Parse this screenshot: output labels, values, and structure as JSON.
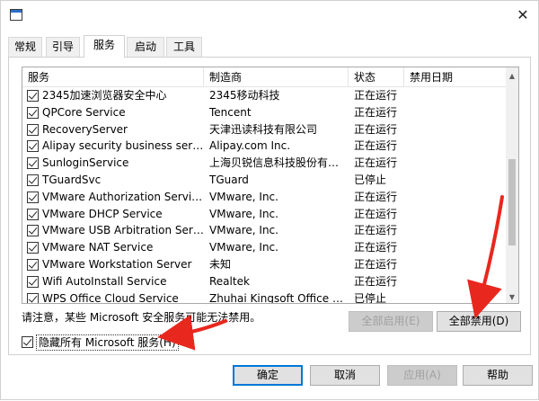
{
  "tabs": [
    "常规",
    "引导",
    "服务",
    "启动",
    "工具"
  ],
  "active_tab": "服务",
  "columns": [
    "服务",
    "制造商",
    "状态",
    "禁用日期"
  ],
  "services": [
    {
      "name": "2345加速浏览器安全中心",
      "maker": "2345移动科技",
      "status": "正在运行"
    },
    {
      "name": "QPCore Service",
      "maker": "Tencent",
      "status": "正在运行"
    },
    {
      "name": "RecoveryServer",
      "maker": "天津迅读科技有限公司",
      "status": "正在运行"
    },
    {
      "name": "Alipay security business service",
      "maker": "Alipay.com Inc.",
      "status": "正在运行"
    },
    {
      "name": "SunloginService",
      "maker": "上海贝锐信息科技股份有限公...",
      "status": "正在运行"
    },
    {
      "name": "TGuardSvc",
      "maker": "TGuard",
      "status": "已停止"
    },
    {
      "name": "VMware Authorization Service",
      "maker": "VMware, Inc.",
      "status": "正在运行"
    },
    {
      "name": "VMware DHCP Service",
      "maker": "VMware, Inc.",
      "status": "正在运行"
    },
    {
      "name": "VMware USB Arbitration Service",
      "maker": "VMware, Inc.",
      "status": "正在运行"
    },
    {
      "name": "VMware NAT Service",
      "maker": "VMware, Inc.",
      "status": "正在运行"
    },
    {
      "name": "VMware Workstation Server",
      "maker": "未知",
      "status": "正在运行"
    },
    {
      "name": "Wifi AutoInstall Service",
      "maker": "Realtek",
      "status": "正在运行"
    },
    {
      "name": "WPS Office Cloud Service",
      "maker": "Zhuhai Kingsoft Office Soft...",
      "status": "已停止"
    }
  ],
  "note": "请注意，某些 Microsoft 安全服务可能无法禁用。",
  "enable_all_label": "全部启用(E)",
  "disable_all_label": "全部禁用(D)",
  "hide_ms_label": "隐藏所有 Microsoft 服务(H)",
  "ok_label": "确定",
  "cancel_label": "取消",
  "apply_label": "应用(A)",
  "help_label": "帮助",
  "close_glyph": "✕",
  "arrow_color": "#e8281e"
}
